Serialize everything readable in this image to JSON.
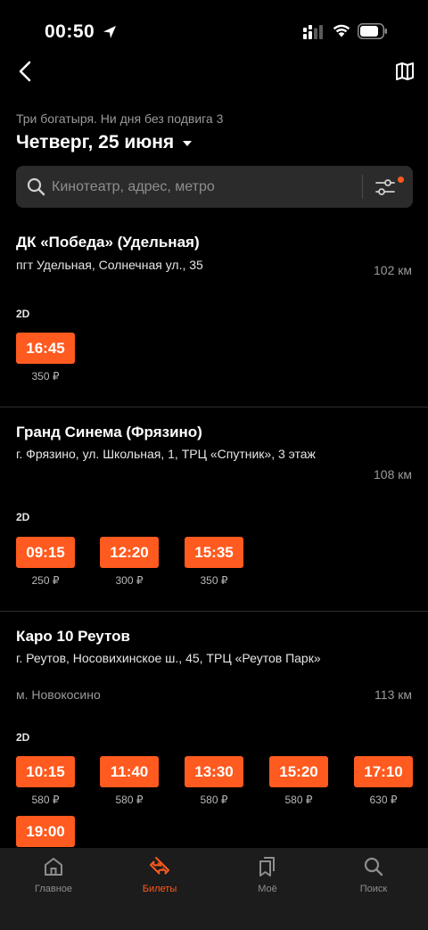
{
  "status_bar": {
    "time": "00:50"
  },
  "header": {
    "film_title": "Три богатыря. Ни дня без подвига 3",
    "date": "Четверг, 25 июня"
  },
  "search": {
    "placeholder": "Кинотеатр, адрес, метро"
  },
  "cinemas": [
    {
      "name": "ДК «Победа» (Удельная)",
      "address": "пгт Удельная, Солнечная ул., 35",
      "distance": "102 км",
      "format": "2D",
      "sessions": [
        {
          "time": "16:45",
          "price": "350 ₽"
        }
      ]
    },
    {
      "name": "Гранд Синема (Фрязино)",
      "address": "г. Фрязино, ул. Школьная, 1, ТРЦ «Спутник», 3 этаж",
      "distance": "108 км",
      "format": "2D",
      "sessions": [
        {
          "time": "09:15",
          "price": "250 ₽"
        },
        {
          "time": "12:20",
          "price": "300 ₽"
        },
        {
          "time": "15:35",
          "price": "350 ₽"
        }
      ]
    },
    {
      "name": "Каро 10 Реутов",
      "address": "г. Реутов, Носовихинское ш., 45, ТРЦ «Реутов Парк»",
      "metro": "м. Новокосино",
      "distance": "113 км",
      "format": "2D",
      "sessions": [
        {
          "time": "10:15",
          "price": "580 ₽"
        },
        {
          "time": "11:40",
          "price": "580 ₽"
        },
        {
          "time": "13:30",
          "price": "580 ₽"
        },
        {
          "time": "15:20",
          "price": "580 ₽"
        },
        {
          "time": "17:10",
          "price": "630 ₽"
        },
        {
          "time": "19:00",
          "price": ""
        }
      ]
    }
  ],
  "tab_bar": {
    "tabs": [
      {
        "label": "Главное",
        "icon": "home-icon"
      },
      {
        "label": "Билеты",
        "icon": "ticket-icon",
        "active": true
      },
      {
        "label": "Моё",
        "icon": "bookmarks-icon"
      },
      {
        "label": "Поиск",
        "icon": "search-icon"
      }
    ]
  },
  "colors": {
    "accent": "#ff5a1f",
    "background": "#000000",
    "tab_bar": "#1c1c1c",
    "search_field": "#2b2b2b"
  }
}
